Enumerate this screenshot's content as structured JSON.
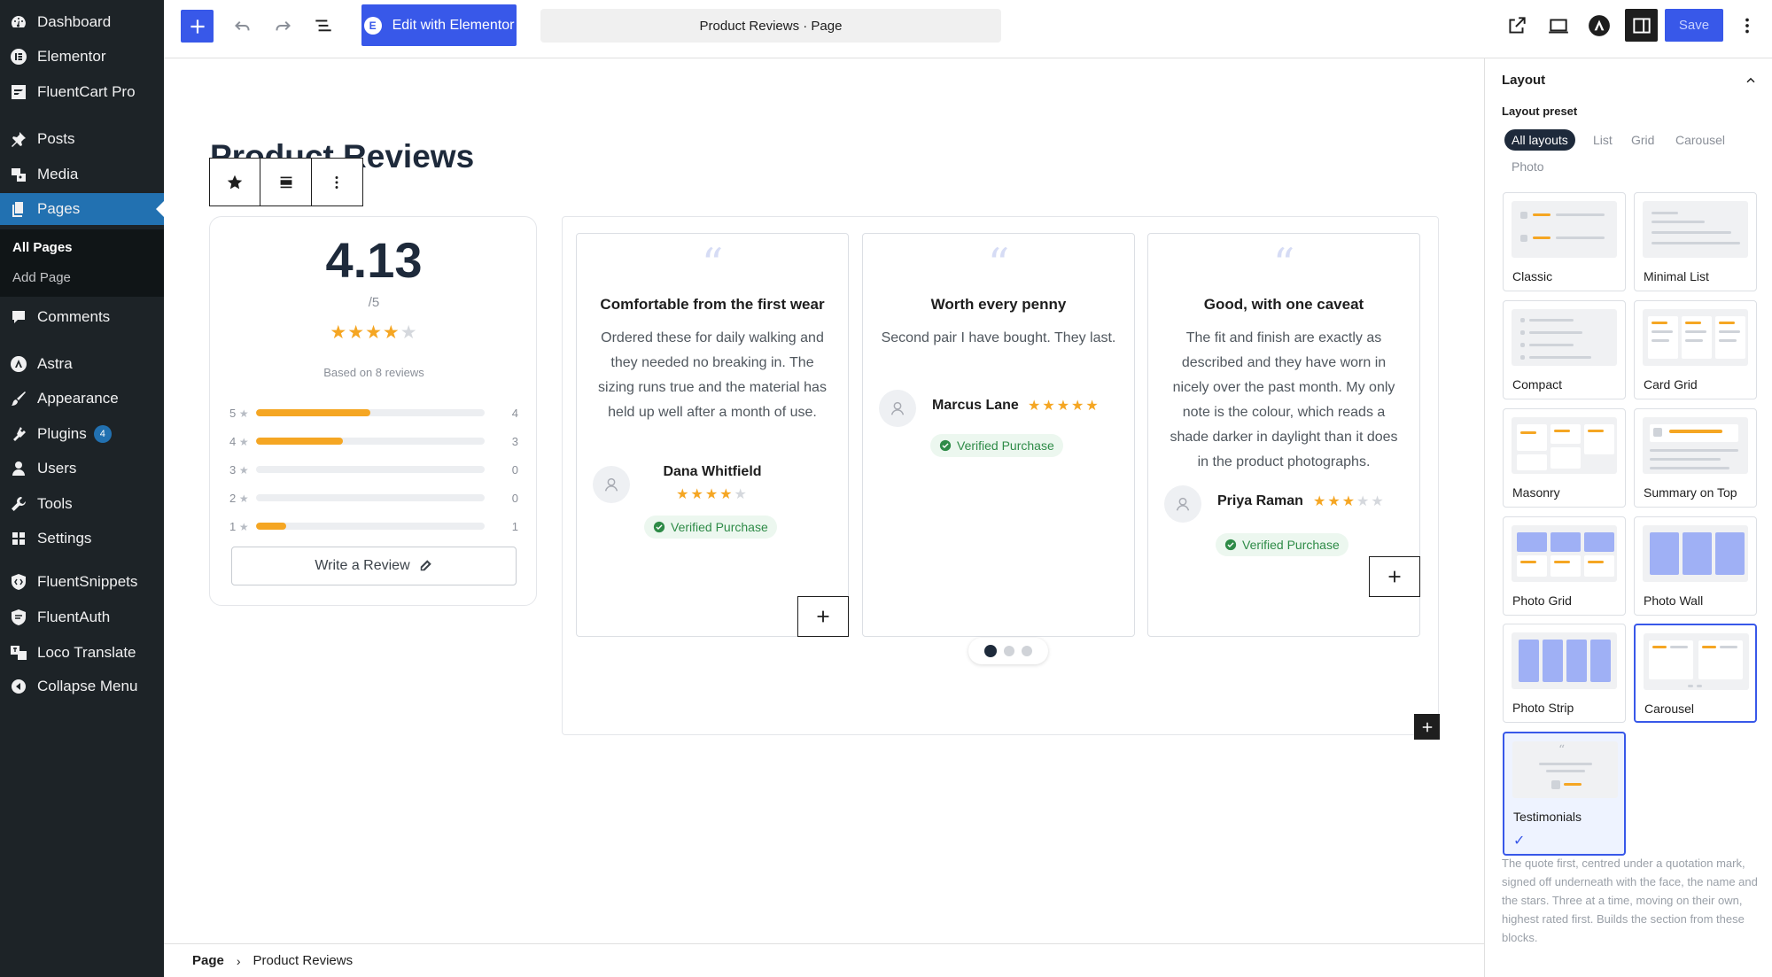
{
  "sidebar": {
    "items": [
      {
        "label": "Dashboard",
        "icon": "dashboard-icon"
      },
      {
        "label": "Elementor",
        "icon": "elementor-icon"
      },
      {
        "label": "FluentCart Pro",
        "icon": "fluentcart-icon"
      },
      {
        "label": "Posts",
        "icon": "pin-icon"
      },
      {
        "label": "Media",
        "icon": "media-icon"
      },
      {
        "label": "Pages",
        "icon": "pages-icon"
      },
      {
        "label": "Comments",
        "icon": "comment-icon"
      },
      {
        "label": "Astra",
        "icon": "astra-icon"
      },
      {
        "label": "Appearance",
        "icon": "brush-icon"
      },
      {
        "label": "Plugins",
        "icon": "plugin-icon",
        "badge": "4"
      },
      {
        "label": "Users",
        "icon": "user-icon"
      },
      {
        "label": "Tools",
        "icon": "wrench-icon"
      },
      {
        "label": "Settings",
        "icon": "settings-icon"
      },
      {
        "label": "FluentSnippets",
        "icon": "shield-code-icon"
      },
      {
        "label": "FluentAuth",
        "icon": "shield-icon"
      },
      {
        "label": "Loco Translate",
        "icon": "translate-icon"
      },
      {
        "label": "Collapse Menu",
        "icon": "collapse-icon"
      }
    ],
    "submenu": {
      "all_pages": "All Pages",
      "add_page": "Add Page"
    }
  },
  "toolbar": {
    "edit_elementor": "Edit with Elementor",
    "doc_title": "Product Reviews · Page",
    "save": "Save"
  },
  "canvas": {
    "heading": "Product Reviews",
    "summary": {
      "average": "4.13",
      "scale": "/5",
      "stars": 4,
      "based_on": "Based on 8 reviews",
      "distribution": [
        {
          "star": "5",
          "count": "4",
          "fraction": 0.5
        },
        {
          "star": "4",
          "count": "3",
          "fraction": 0.38
        },
        {
          "star": "3",
          "count": "0",
          "fraction": 0
        },
        {
          "star": "2",
          "count": "0",
          "fraction": 0
        },
        {
          "star": "1",
          "count": "1",
          "fraction": 0.13
        }
      ],
      "write_review": "Write a Review"
    },
    "reviews": [
      {
        "title": "Comfortable from the first wear",
        "body": "Ordered these for daily walking and they needed no breaking in. The sizing runs true and the material has held up well after a month of use.",
        "author": "Dana Whitfield",
        "rating": 4,
        "verified": "Verified Purchase"
      },
      {
        "title": "Worth every penny",
        "body": "Second pair I have bought. They last.",
        "author": "Marcus Lane",
        "rating": 5,
        "verified": "Verified Purchase"
      },
      {
        "title": "Good, with one caveat",
        "body": "The fit and finish are exactly as described and they have worn in nicely over the past month. My only note is the colour, which reads a shade darker in daylight than it does in the product photographs.",
        "author": "Priya Raman",
        "rating": 3,
        "verified": "Verified Purchase"
      }
    ],
    "carousel_dots": {
      "count": 3,
      "active": 0
    }
  },
  "footer": {
    "crumb_root": "Page",
    "crumb_current": "Product Reviews"
  },
  "panel": {
    "section": "Layout",
    "preset_label": "Layout preset",
    "chips": [
      "All layouts",
      "List",
      "Grid",
      "Carousel",
      "Photo"
    ],
    "active_chip": "All layouts",
    "layouts": [
      "Classic",
      "Minimal List",
      "Compact",
      "Card Grid",
      "Masonry",
      "Summary on Top",
      "Photo Grid",
      "Photo Wall",
      "Photo Strip",
      "Carousel",
      "Testimonials"
    ],
    "selected_layout": "Testimonials",
    "description": "The quote first, centred under a quotation mark, signed off underneath with the face, the name and the stars. Three at a time, moving on their own, highest rated first. Builds the section from these blocks."
  },
  "colors": {
    "accent": "#3858e9",
    "star": "#f5a623",
    "verified": "#2e8b47",
    "sidebar": "#1d2327"
  }
}
